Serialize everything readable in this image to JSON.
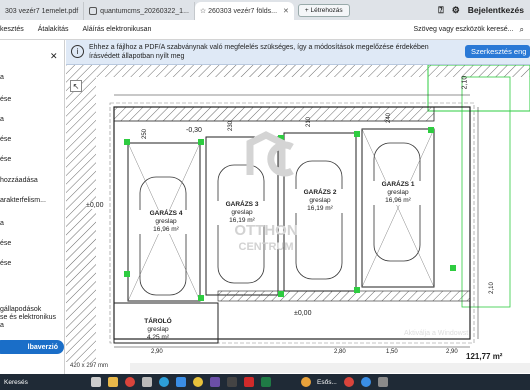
{
  "browser": {
    "tabs": [
      {
        "label": "303 vezér7 1emelet.pdf"
      },
      {
        "label": "quantumcms_20260322_1..."
      },
      {
        "label": "260303 vezér7 földs..."
      }
    ],
    "new_tab_label": "+ Létrehozás",
    "help_icon": "help-icon",
    "settings_icon": "gear-icon",
    "signin_label": "Bejelentkezés"
  },
  "commandbar": {
    "items": [
      "kesztés",
      "Átalakítás",
      "Aláírás elektronikusan"
    ],
    "search_placeholder": "Szöveg vagy eszközök keresé...",
    "search_icon": "search-icon"
  },
  "leftpanel": {
    "items": [
      "a",
      "ése",
      "a",
      "ése",
      "ése",
      "hozzáadása",
      "arakterfelism...",
      "a",
      "ése",
      "ése"
    ],
    "promo_lines": [
      "gállapodások",
      "se és elektronikus",
      "a"
    ],
    "convert_label": "lbaverzió"
  },
  "notice": {
    "text": "Ehhez a fájlhoz a PDF/A szabványnak való megfelelés szükséges, így a módosítások megelőzése érdekében írásvédett állapotban nyílt meg",
    "edit_button": "Szerkesztés eng"
  },
  "drawing": {
    "garages": [
      {
        "title": "GARÁZS 4",
        "floor": "greslap",
        "area": "16,96 m²"
      },
      {
        "title": "GARÁZS 3",
        "floor": "greslap",
        "area": "16,19 m²"
      },
      {
        "title": "GARÁZS 2",
        "floor": "greslap",
        "area": "16,19 m²"
      },
      {
        "title": "GARÁZS 1",
        "floor": "greslap",
        "area": "16,96 m²"
      }
    ],
    "storage": {
      "title": "TÁROLÓ",
      "floor": "greslap",
      "area": "4,25 m²"
    },
    "levels": [
      "-0,30",
      "±0,00",
      "±0,00"
    ],
    "dims_top": [
      "250",
      "230",
      "210",
      "240",
      "2,10"
    ],
    "dims_bottom": [
      "2,90",
      "2,80",
      "1,50",
      "2,90"
    ],
    "logo_top": "OTTHON",
    "logo_bottom": "CENTRUM",
    "side_dim": "2,10",
    "bottom_right": "121,77 m²"
  },
  "status": {
    "page_size": "420 x 297 mm",
    "activation": "Aktiválja a Windowst"
  },
  "taskbar": {
    "search_text": "Keresés",
    "tray_text": "Esős..."
  },
  "colors": {
    "accent": "#2a79d6",
    "marker": "#2ecc40",
    "notice_bg": "#dfe9f6"
  }
}
